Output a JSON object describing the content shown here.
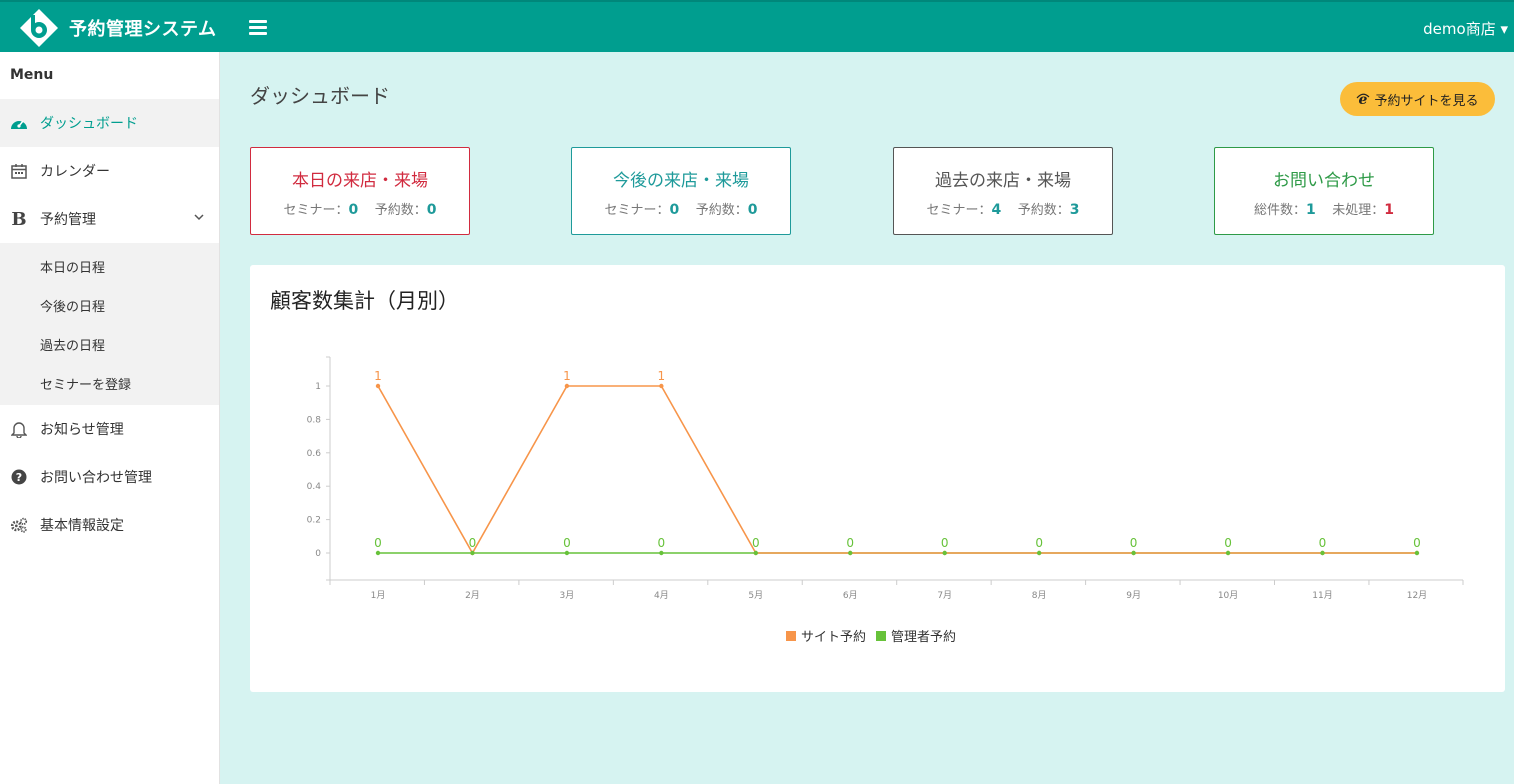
{
  "header": {
    "app_title": "予約管理システム",
    "user_label": "demo商店 ▾"
  },
  "sidebar": {
    "heading": "Menu",
    "items": [
      {
        "label": "ダッシュボード",
        "icon": "dashboard-icon",
        "active": true
      },
      {
        "label": "カレンダー",
        "icon": "calendar-icon"
      },
      {
        "label": "予約管理",
        "icon": "booking-b-icon",
        "expanded": true
      },
      {
        "label": "お知らせ管理",
        "icon": "bell-icon"
      },
      {
        "label": "お問い合わせ管理",
        "icon": "question-icon"
      },
      {
        "label": "基本情報設定",
        "icon": "gears-icon"
      }
    ],
    "submenu": [
      "本日の日程",
      "今後の日程",
      "過去の日程",
      "セミナーを登録"
    ]
  },
  "main": {
    "title": "ダッシュボード",
    "view_site_button": "予約サイトを見る",
    "cards": [
      {
        "title": "本日の来店・来場",
        "label1": "セミナー：",
        "value1": "0",
        "label2": "予約数：",
        "value2": "0"
      },
      {
        "title": "今後の来店・来場",
        "label1": "セミナー：",
        "value1": "0",
        "label2": "予約数：",
        "value2": "0"
      },
      {
        "title": "過去の来店・来場",
        "label1": "セミナー：",
        "value1": "4",
        "label2": "予約数：",
        "value2": "3"
      },
      {
        "title": "お問い合わせ",
        "label1": "総件数：",
        "value1": "1",
        "label2": "未処理：",
        "value2": "1"
      }
    ]
  },
  "colors": {
    "header": "#009e8f",
    "background": "#d6f3f1",
    "site_series": "#f7954a",
    "admin_series": "#67c23a",
    "button": "#fbbd3a"
  },
  "chart_data": {
    "type": "line",
    "title": "顧客数集計（月別）",
    "categories": [
      "1月",
      "2月",
      "3月",
      "4月",
      "5月",
      "6月",
      "7月",
      "8月",
      "9月",
      "10月",
      "11月",
      "12月"
    ],
    "series": [
      {
        "name": "サイト予約",
        "values": [
          1,
          0,
          1,
          1,
          0,
          0,
          0,
          0,
          0,
          0,
          0,
          0
        ]
      },
      {
        "name": "管理者予約",
        "values": [
          0,
          0,
          0,
          0,
          0,
          0,
          0,
          0,
          0,
          0,
          0,
          0
        ]
      }
    ],
    "yticks": [
      "0",
      "0.2",
      "0.4",
      "0.6",
      "0.8",
      "1"
    ],
    "ylim": [
      0,
      1
    ],
    "legend_position": "bottom",
    "data_labels": true
  }
}
